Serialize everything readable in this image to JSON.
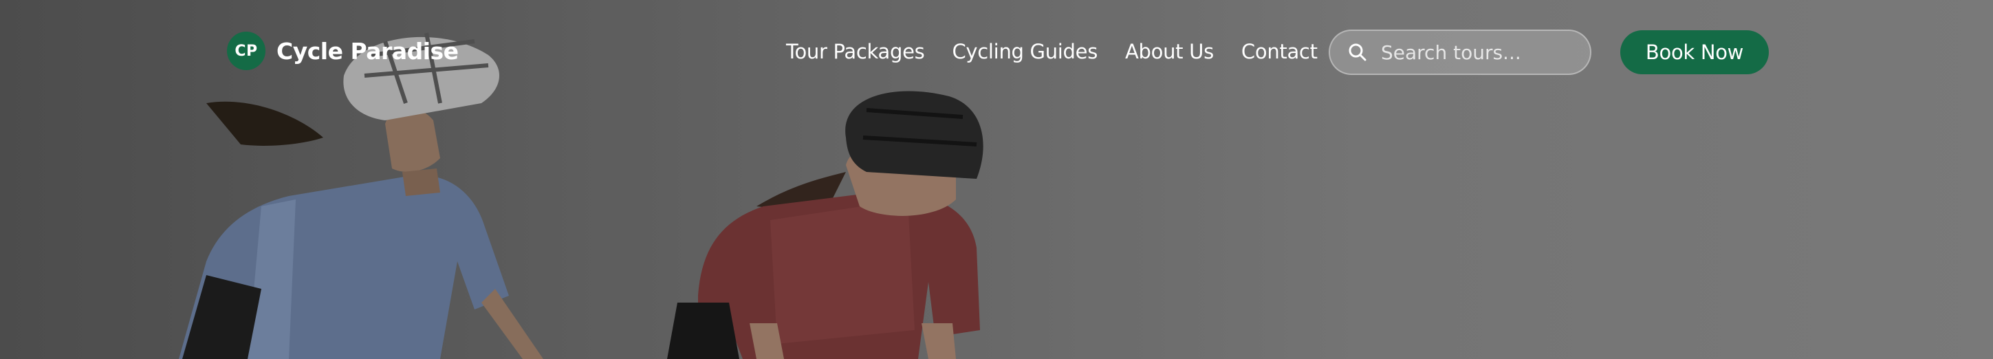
{
  "brand": {
    "initials": "CP",
    "name": "Cycle Paradise",
    "accent_color": "#146b46"
  },
  "nav": {
    "links": [
      {
        "label": "Tour Packages"
      },
      {
        "label": "Cycling Guides"
      },
      {
        "label": "About Us"
      },
      {
        "label": "Contact"
      }
    ]
  },
  "search": {
    "placeholder": "Search tours...",
    "value": "",
    "icon": "search-icon"
  },
  "cta": {
    "label": "Book Now"
  },
  "hero": {
    "image": "two-cyclists-riding-photo"
  }
}
